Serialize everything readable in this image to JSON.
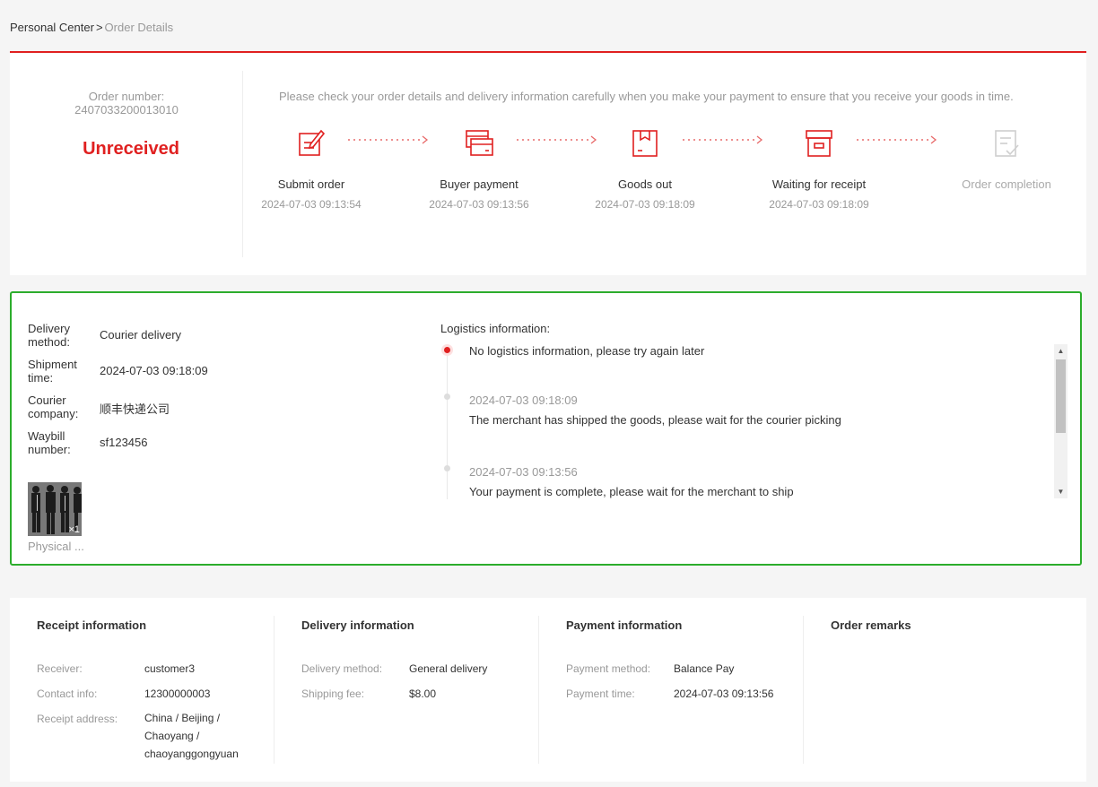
{
  "breadcrumb": {
    "root": "Personal Center",
    "separator": ">",
    "current": "Order Details"
  },
  "order": {
    "number_label": "Order number:",
    "number": "2407033200013010",
    "status": "Unreceived",
    "notice": "Please check your order details and delivery information carefully when you make your payment to ensure that you receive your goods in time."
  },
  "steps": [
    {
      "label": "Submit order",
      "time": "2024-07-03 09:13:54",
      "icon": "edit-icon",
      "done": true
    },
    {
      "label": "Buyer payment",
      "time": "2024-07-03 09:13:56",
      "icon": "card-icon",
      "done": true
    },
    {
      "label": "Goods out",
      "time": "2024-07-03 09:18:09",
      "icon": "package-icon",
      "done": true
    },
    {
      "label": "Waiting for receipt",
      "time": "2024-07-03 09:18:09",
      "icon": "box-icon",
      "done": true
    },
    {
      "label": "Order completion",
      "time": "",
      "icon": "checklist-icon",
      "done": false
    }
  ],
  "shipment": {
    "method_label": "Delivery method:",
    "method": "Courier delivery",
    "time_label": "Shipment time:",
    "time": "2024-07-03 09:18:09",
    "courier_label": "Courier company:",
    "courier": "顺丰快递公司",
    "waybill_label": "Waybill number:",
    "waybill": "sf123456",
    "product_qty": "×1",
    "product_name": "Physical ..."
  },
  "logistics": {
    "title": "Logistics information:",
    "items": [
      {
        "time": "",
        "text": "No logistics information, please try again later"
      },
      {
        "time": "2024-07-03 09:18:09",
        "text": "The merchant has shipped the goods, please wait for the courier picking"
      },
      {
        "time": "2024-07-03 09:13:56",
        "text": "Your payment is complete, please wait for the merchant to ship"
      }
    ]
  },
  "receipt": {
    "title": "Receipt information",
    "receiver_label": "Receiver:",
    "receiver": "customer3",
    "contact_label": "Contact info:",
    "contact": "12300000003",
    "address_label": "Receipt address:",
    "address": "China / Beijing / Chaoyang / chaoyanggongyuan"
  },
  "delivery": {
    "title": "Delivery information",
    "method_label": "Delivery method:",
    "method": "General delivery",
    "fee_label": "Shipping fee:",
    "fee": "$8.00"
  },
  "payment": {
    "title": "Payment information",
    "method_label": "Payment method:",
    "method": "Balance Pay",
    "time_label": "Payment time:",
    "time": "2024-07-03 09:13:56"
  },
  "remarks": {
    "title": "Order remarks"
  },
  "colors": {
    "accent": "#e02020",
    "highlight_border": "#2cad2c",
    "muted": "#999999"
  }
}
